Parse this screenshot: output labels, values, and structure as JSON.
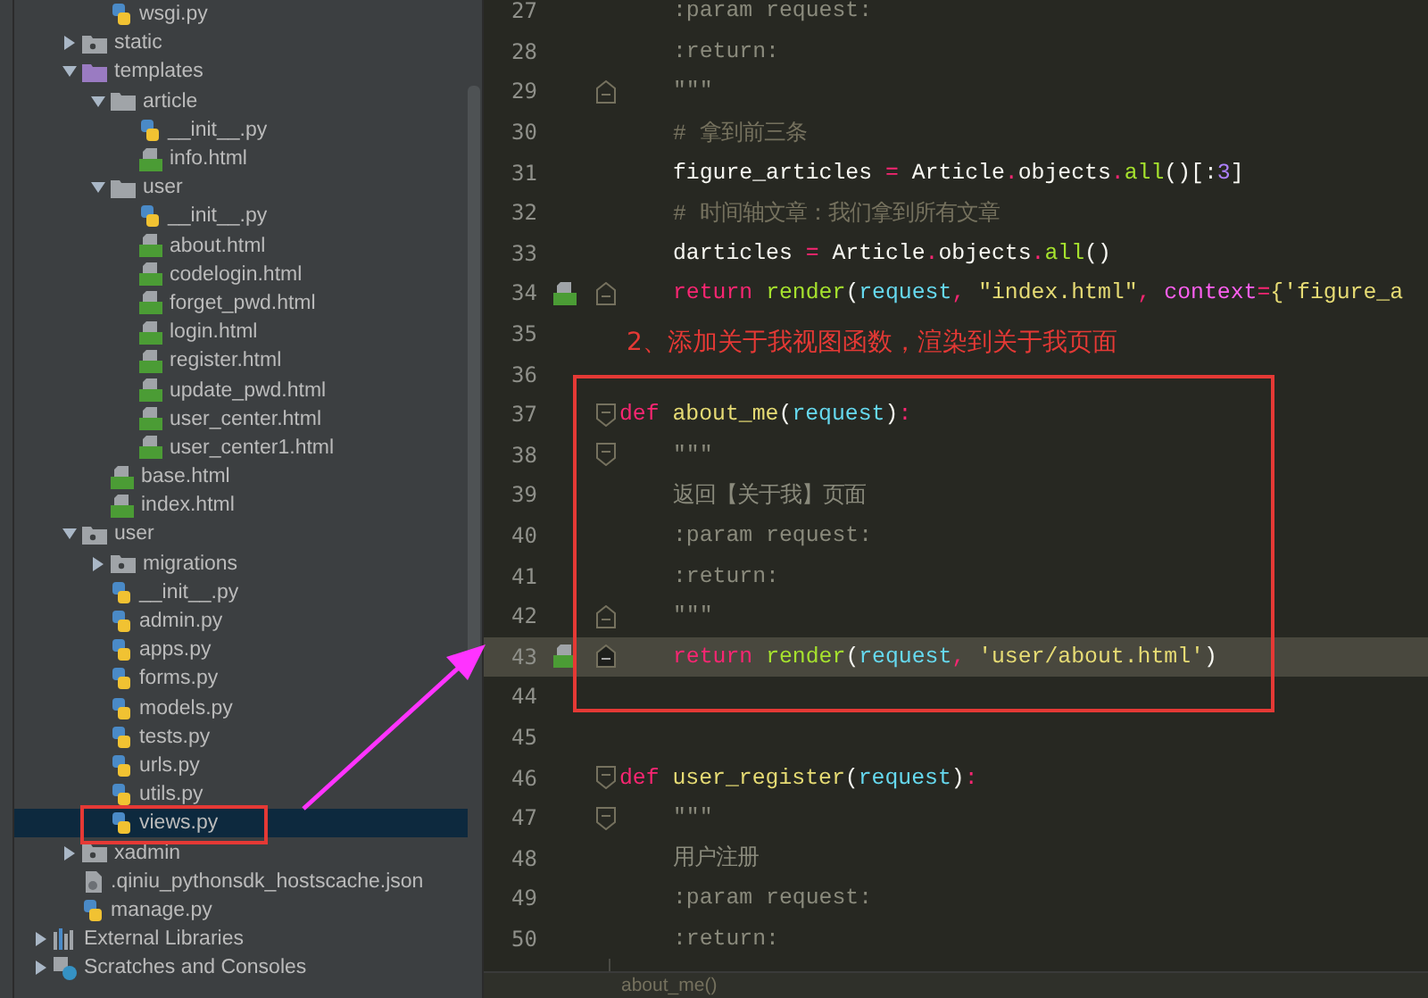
{
  "project_tree": {
    "cut_folder_files": [
      {
        "name": "wsgi.py",
        "kind": "py",
        "selected": false
      }
    ],
    "items": [
      {
        "name": "static",
        "kind": "package",
        "expanded": false,
        "selected": false
      },
      {
        "name": "templates",
        "kind": "template_folder",
        "expanded": true,
        "selected": false,
        "children": [
          {
            "name": "article",
            "kind": "folder",
            "expanded": true,
            "selected": false,
            "children": [
              {
                "name": "__init__.py",
                "kind": "py",
                "selected": false
              },
              {
                "name": "info.html",
                "kind": "html",
                "selected": false
              }
            ]
          },
          {
            "name": "user",
            "kind": "folder",
            "expanded": true,
            "selected": false,
            "children": [
              {
                "name": "__init__.py",
                "kind": "py",
                "selected": false
              },
              {
                "name": "about.html",
                "kind": "html",
                "selected": false
              },
              {
                "name": "codelogin.html",
                "kind": "html",
                "selected": false
              },
              {
                "name": "forget_pwd.html",
                "kind": "html",
                "selected": false
              },
              {
                "name": "login.html",
                "kind": "html",
                "selected": false
              },
              {
                "name": "register.html",
                "kind": "html",
                "selected": false
              },
              {
                "name": "update_pwd.html",
                "kind": "html",
                "selected": false
              },
              {
                "name": "user_center.html",
                "kind": "html",
                "selected": false
              },
              {
                "name": "user_center1.html",
                "kind": "html",
                "selected": false
              }
            ]
          },
          {
            "name": "base.html",
            "kind": "html",
            "selected": false
          },
          {
            "name": "index.html",
            "kind": "html",
            "selected": false
          }
        ]
      },
      {
        "name": "user",
        "kind": "package",
        "expanded": true,
        "selected": false,
        "children": [
          {
            "name": "migrations",
            "kind": "package",
            "expanded": false,
            "selected": false
          },
          {
            "name": "__init__.py",
            "kind": "py",
            "selected": false
          },
          {
            "name": "admin.py",
            "kind": "py",
            "selected": false
          },
          {
            "name": "apps.py",
            "kind": "py",
            "selected": false
          },
          {
            "name": "forms.py",
            "kind": "py",
            "selected": false
          },
          {
            "name": "models.py",
            "kind": "py",
            "selected": false
          },
          {
            "name": "tests.py",
            "kind": "py",
            "selected": false
          },
          {
            "name": "urls.py",
            "kind": "py",
            "selected": false
          },
          {
            "name": "utils.py",
            "kind": "py",
            "selected": false
          },
          {
            "name": "views.py",
            "kind": "py",
            "selected": true
          }
        ]
      },
      {
        "name": "xadmin",
        "kind": "package",
        "expanded": false,
        "selected": false
      },
      {
        "name": ".qiniu_pythonsdk_hostscache.json",
        "kind": "json",
        "selected": false
      },
      {
        "name": "manage.py",
        "kind": "py",
        "selected": false
      }
    ],
    "roots": [
      {
        "name": "External Libraries",
        "kind": "library",
        "expanded": false,
        "selected": false
      },
      {
        "name": "Scratches and Consoles",
        "kind": "scratches",
        "expanded": false,
        "selected": false
      }
    ]
  },
  "editor": {
    "lines": [
      {
        "number": "27",
        "indented": true,
        "current": false,
        "template_link": false,
        "tokens": [
          {
            "t": ":param request:",
            "kind": "doc"
          }
        ]
      },
      {
        "number": "28",
        "indented": true,
        "current": false,
        "template_link": false,
        "tokens": [
          {
            "t": ":return:",
            "kind": "doc"
          }
        ]
      },
      {
        "number": "29",
        "indented": true,
        "current": false,
        "template_link": false,
        "fold": {
          "kind": "end"
        },
        "tokens": [
          {
            "t": "\"\"\"",
            "kind": "doc"
          }
        ]
      },
      {
        "number": "30",
        "indented": true,
        "current": false,
        "template_link": false,
        "tokens": [
          {
            "t": "# 拿到前三条",
            "kind": "comment"
          }
        ]
      },
      {
        "number": "31",
        "indented": true,
        "current": false,
        "template_link": false,
        "tokens": [
          {
            "t": "figure_articles ",
            "kind": "plain"
          },
          {
            "t": "=",
            "kind": "op"
          },
          {
            "t": " Article",
            "kind": "plain"
          },
          {
            "t": ".",
            "kind": "op"
          },
          {
            "t": "objects",
            "kind": "plain"
          },
          {
            "t": ".",
            "kind": "op"
          },
          {
            "t": "all",
            "kind": "call"
          },
          {
            "t": "()[:",
            "kind": "plain"
          },
          {
            "t": "3",
            "kind": "number"
          },
          {
            "t": "]",
            "kind": "plain"
          }
        ]
      },
      {
        "number": "32",
        "indented": true,
        "current": false,
        "template_link": false,
        "tokens": [
          {
            "t": "# 时间轴文章：我们拿到所有文章",
            "kind": "comment"
          }
        ]
      },
      {
        "number": "33",
        "indented": true,
        "current": false,
        "template_link": false,
        "tokens": [
          {
            "t": "darticles ",
            "kind": "plain"
          },
          {
            "t": "=",
            "kind": "op"
          },
          {
            "t": " Article",
            "kind": "plain"
          },
          {
            "t": ".",
            "kind": "op"
          },
          {
            "t": "objects",
            "kind": "plain"
          },
          {
            "t": ".",
            "kind": "op"
          },
          {
            "t": "all",
            "kind": "call"
          },
          {
            "t": "()",
            "kind": "plain"
          }
        ]
      },
      {
        "number": "34",
        "indented": true,
        "current": false,
        "template_link": true,
        "fold": {
          "kind": "end"
        },
        "tokens": [
          {
            "t": "return ",
            "kind": "keyword"
          },
          {
            "t": "render",
            "kind": "call"
          },
          {
            "t": "(",
            "kind": "plain"
          },
          {
            "t": "request",
            "kind": "param"
          },
          {
            "t": ", ",
            "kind": "op"
          },
          {
            "t": "\"index.html\"",
            "kind": "string"
          },
          {
            "t": ", ",
            "kind": "op"
          },
          {
            "t": "context",
            "kind": "kwarg"
          },
          {
            "t": "=",
            "kind": "op"
          },
          {
            "t": "{'figure_a",
            "kind": "string"
          }
        ]
      },
      {
        "number": "35",
        "current": false,
        "template_link": false,
        "note": "2、添加关于我视图函数，渲染到关于我页面"
      },
      {
        "number": "36",
        "current": false,
        "template_link": false
      },
      {
        "number": "37",
        "indented": false,
        "current": false,
        "template_link": false,
        "fold": {
          "kind": "start"
        },
        "tokens": [
          {
            "t": "def ",
            "kind": "keyword"
          },
          {
            "t": "about_me",
            "kind": "fn"
          },
          {
            "t": "(",
            "kind": "plain"
          },
          {
            "t": "request",
            "kind": "param"
          },
          {
            "t": ")",
            "kind": "plain"
          },
          {
            "t": ":",
            "kind": "op"
          }
        ]
      },
      {
        "number": "38",
        "indented": true,
        "current": false,
        "template_link": false,
        "fold": {
          "kind": "start"
        },
        "tokens": [
          {
            "t": "\"\"\"",
            "kind": "doc"
          }
        ]
      },
      {
        "number": "39",
        "indented": true,
        "current": false,
        "template_link": false,
        "tokens": [
          {
            "t": "返回【关于我】页面",
            "kind": "doc"
          }
        ]
      },
      {
        "number": "40",
        "indented": true,
        "current": false,
        "template_link": false,
        "tokens": [
          {
            "t": ":param request:",
            "kind": "doc"
          }
        ]
      },
      {
        "number": "41",
        "indented": true,
        "current": false,
        "template_link": false,
        "tokens": [
          {
            "t": ":return:",
            "kind": "doc"
          }
        ]
      },
      {
        "number": "42",
        "indented": true,
        "current": false,
        "template_link": false,
        "fold": {
          "kind": "end"
        },
        "tokens": [
          {
            "t": "\"\"\"",
            "kind": "doc"
          }
        ]
      },
      {
        "number": "43",
        "indented": true,
        "current": true,
        "template_link": true,
        "fold": {
          "kind": "end"
        },
        "tokens": [
          {
            "t": "return ",
            "kind": "keyword"
          },
          {
            "t": "render",
            "kind": "call"
          },
          {
            "t": "(",
            "kind": "plain"
          },
          {
            "t": "request",
            "kind": "param"
          },
          {
            "t": ", ",
            "kind": "op"
          },
          {
            "t": "'user/about.html'",
            "kind": "string"
          },
          {
            "t": ")",
            "kind": "plain"
          }
        ]
      },
      {
        "number": "44",
        "current": false,
        "template_link": false
      },
      {
        "number": "45",
        "current": false,
        "template_link": false
      },
      {
        "number": "46",
        "indented": false,
        "current": false,
        "template_link": false,
        "fold": {
          "kind": "start"
        },
        "tokens": [
          {
            "t": "def ",
            "kind": "keyword"
          },
          {
            "t": "user_register",
            "kind": "fn"
          },
          {
            "t": "(",
            "kind": "plain"
          },
          {
            "t": "request",
            "kind": "param"
          },
          {
            "t": ")",
            "kind": "plain"
          },
          {
            "t": ":",
            "kind": "op"
          }
        ]
      },
      {
        "number": "47",
        "indented": true,
        "current": false,
        "template_link": false,
        "fold": {
          "kind": "start"
        },
        "tokens": [
          {
            "t": "\"\"\"",
            "kind": "doc"
          }
        ]
      },
      {
        "number": "48",
        "indented": true,
        "current": false,
        "template_link": false,
        "tokens": [
          {
            "t": "用户注册",
            "kind": "doc"
          }
        ]
      },
      {
        "number": "49",
        "indented": true,
        "current": false,
        "template_link": false,
        "tokens": [
          {
            "t": ":param request:",
            "kind": "doc"
          }
        ]
      },
      {
        "number": "50",
        "indented": true,
        "current": false,
        "template_link": false,
        "tokens": [
          {
            "t": ":return:",
            "kind": "doc"
          }
        ]
      }
    ],
    "breadcrumb": "about_me()"
  }
}
